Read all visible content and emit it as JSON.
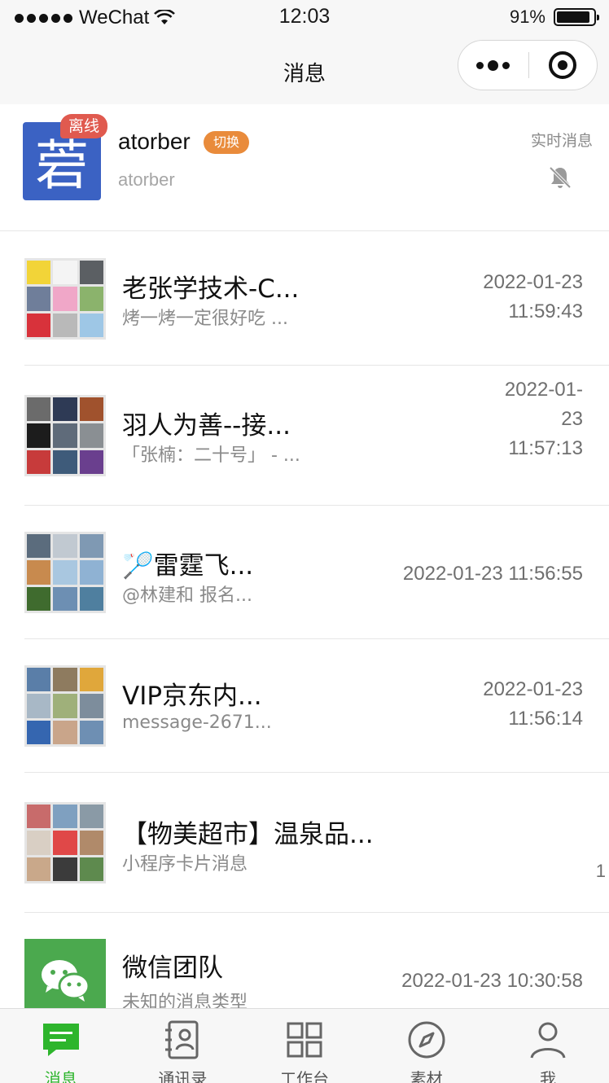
{
  "status_bar": {
    "carrier": "WeChat",
    "time": "12:03",
    "battery": "91%"
  },
  "nav": {
    "title": "消息"
  },
  "account": {
    "avatar_char": "菪",
    "offline_badge": "离线",
    "name": "atorber",
    "switch_tag": "切换",
    "subtitle": "atorber",
    "realtime_label": "实时消息"
  },
  "conversations": [
    {
      "title": "老张学技术-C...",
      "preview": "烤一烤一定很好吃 ...",
      "time_line1": "2022-01-23",
      "time_line2": "11:59:43",
      "time_line3": ""
    },
    {
      "title": "羽人为善--接...",
      "preview": "「张楠：二十号」 - ...",
      "time_line1": "2022-01-",
      "time_line2": "23",
      "time_line3": "11:57:13"
    },
    {
      "title": "🏸雷霆飞...",
      "preview": "@林建和 报名...",
      "time_line1": "2022-01-23 11:56:55",
      "time_line2": "",
      "time_line3": ""
    },
    {
      "title": "VIP京东内...",
      "preview": "message-2671...",
      "time_line1": "2022-01-23",
      "time_line2": "11:56:14",
      "time_line3": ""
    },
    {
      "title": "【物美超市】温泉品...",
      "preview": "小程序卡片消息",
      "time_line1": "",
      "time_line2": "",
      "time_line3": "",
      "stray": "1"
    },
    {
      "title": "微信团队",
      "preview": "未知的消息类型",
      "time_line1": "2022-01-23 10:30:58",
      "time_line2": "",
      "time_line3": ""
    }
  ],
  "tabs": [
    {
      "label": "消息",
      "icon": "message-icon",
      "active": true
    },
    {
      "label": "通讯录",
      "icon": "contacts-icon",
      "active": false
    },
    {
      "label": "工作台",
      "icon": "workspace-icon",
      "active": false
    },
    {
      "label": "素材",
      "icon": "compass-icon",
      "active": false
    },
    {
      "label": "我",
      "icon": "profile-icon",
      "active": false
    }
  ],
  "colors": {
    "accent_green": "#2db52c",
    "offline_red": "#e05a4f",
    "switch_orange": "#e98b3b",
    "avatar_blue": "#3b62c3",
    "wechat_green": "#4ba94e"
  }
}
